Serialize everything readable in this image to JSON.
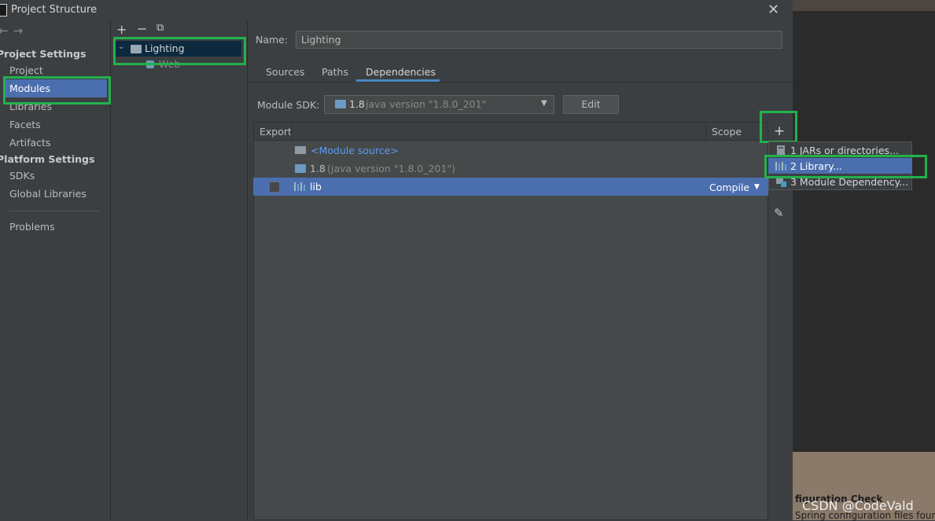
{
  "window": {
    "title": "Project Structure"
  },
  "left_nav": {
    "project_settings_header": "Project Settings",
    "items_project": [
      "Project",
      "Modules",
      "Libraries",
      "Facets",
      "Artifacts"
    ],
    "platform_settings_header": "Platform Settings",
    "items_platform": [
      "SDKs",
      "Global Libraries"
    ],
    "problems": "Problems",
    "selected": "Modules"
  },
  "module_tree": {
    "root": "Lighting",
    "child": "Web"
  },
  "module": {
    "name_label": "Name:",
    "name_value": "Lighting",
    "tabs": [
      "Sources",
      "Paths",
      "Dependencies"
    ],
    "active_tab": "Dependencies",
    "sdk_label": "Module SDK:",
    "sdk_version": "1.8",
    "sdk_detail": "java version \"1.8.0_201\"",
    "edit_label": "Edit"
  },
  "dependencies": {
    "col_export": "Export",
    "col_scope": "Scope",
    "rows": [
      {
        "name": "<Module source>",
        "detail": "",
        "scope": ""
      },
      {
        "name": "1.8",
        "detail": "(java version \"1.8.0_201\")",
        "scope": ""
      },
      {
        "name": "lib",
        "detail": "",
        "scope": "Compile"
      }
    ]
  },
  "add_popup": {
    "items": [
      "1  JARs or directories...",
      "2  Library...",
      "3  Module Dependency..."
    ],
    "selected": "2  Library..."
  },
  "background": {
    "text1": "figuration Check",
    "text2": "Spring configuration files found",
    "watermark": "CSDN @CodeVald"
  },
  "colors": {
    "selection": "#4b6eaf",
    "highlight_box": "#22b14c",
    "link": "#589df6"
  }
}
